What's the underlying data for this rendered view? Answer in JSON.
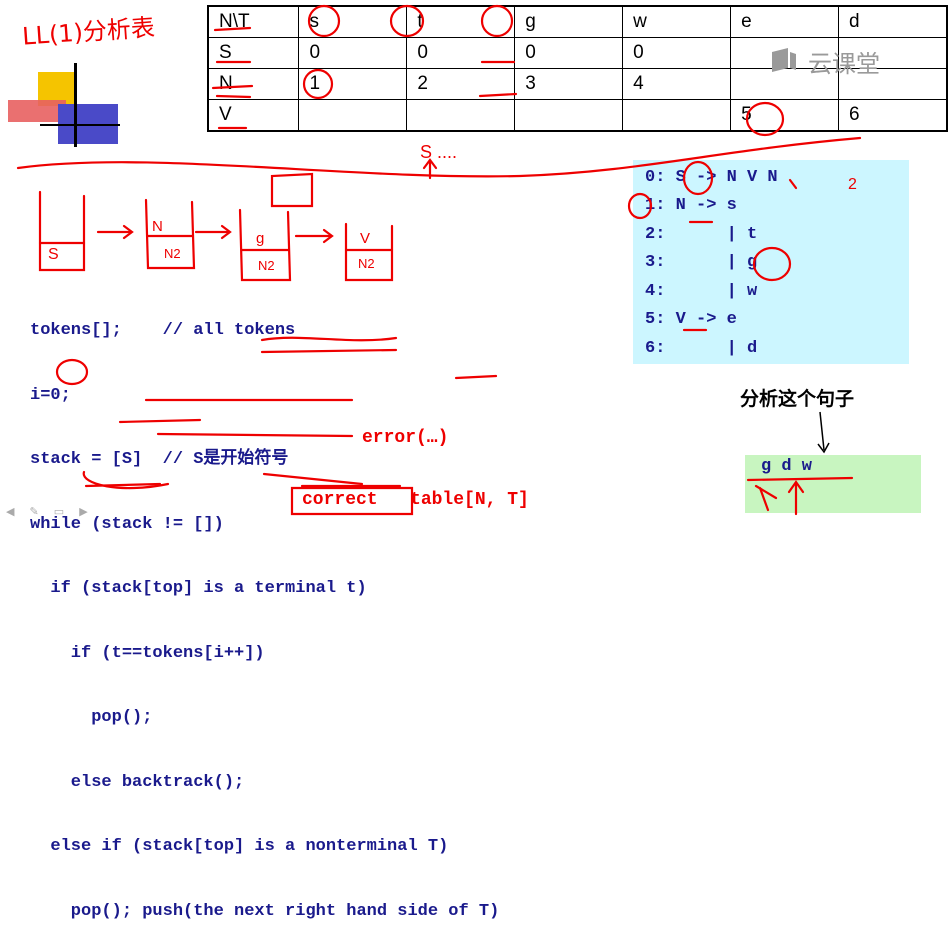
{
  "handwritten_title": "LL(1)分析表",
  "table": {
    "header": [
      "N\\T",
      "s",
      "t",
      "g",
      "w",
      "e",
      "d"
    ],
    "rows": [
      [
        "S",
        "0",
        "0",
        "0",
        "0",
        "",
        ""
      ],
      [
        "N",
        "1",
        "2",
        "3",
        "4",
        "",
        ""
      ],
      [
        "V",
        "",
        "",
        "",
        "",
        "5",
        "6"
      ]
    ]
  },
  "logo": {
    "text": "云课堂"
  },
  "grammar": [
    "0: S -> N V N",
    "1: N -> s",
    "2:      | t",
    "3:      | g",
    "4:      | w",
    "5: V -> e",
    "6:      | d"
  ],
  "code": [
    "tokens[];    // all tokens",
    "i=0;",
    "stack = [S]  // S是开始符号",
    "while (stack != [])",
    "  if (stack[top] is a terminal t)",
    "    if (t==tokens[i++])",
    "      pop();",
    "    else backtrack();",
    "  else if (stack[top] is a nonterminal T)",
    "    pop(); push(the next right hand side of T)"
  ],
  "annotations": {
    "error": "error(…)",
    "correct": "correct   table[N, T]",
    "n2": "2",
    "s_dots": "S ....",
    "stack_labels": [
      "S",
      "N",
      "N2",
      "g",
      "N2",
      "V",
      "N2"
    ]
  },
  "sentence_label": "分析这个句子",
  "sentence": "g d w"
}
